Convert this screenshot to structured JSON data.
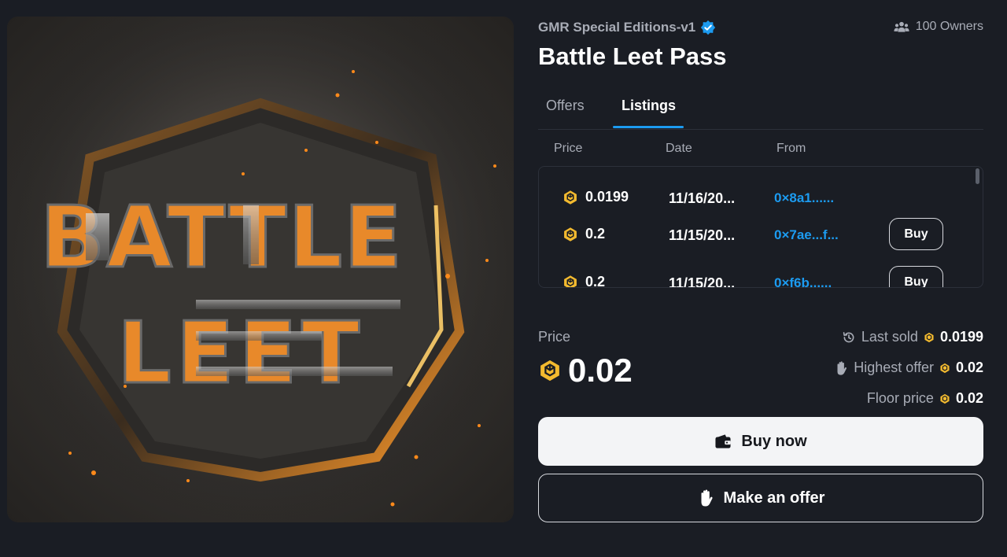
{
  "artwork": {
    "alt_text_logo": "BATTLE LEET"
  },
  "header": {
    "collection_name": "GMR Special Editions-v1",
    "owners_text": "100 Owners",
    "title": "Battle Leet Pass"
  },
  "tabs": [
    {
      "label": "Offers",
      "active": false
    },
    {
      "label": "Listings",
      "active": true
    }
  ],
  "listings": {
    "columns": [
      "Price",
      "Date",
      "From"
    ],
    "rows": [
      {
        "price": "0.0199",
        "date": "11/16/20...",
        "from": "0×8a1......",
        "action": ""
      },
      {
        "price": "0.2",
        "date": "11/15/20...",
        "from": "0×7ae...f...",
        "action": "Buy"
      },
      {
        "price": "0.2",
        "date": "11/15/20...",
        "from": "0×f6b......",
        "action": "Buy"
      }
    ]
  },
  "pricing": {
    "label": "Price",
    "value": "0.02",
    "last_sold_label": "Last sold",
    "last_sold_value": "0.0199",
    "highest_offer_label": "Highest offer",
    "highest_offer_value": "0.02",
    "floor_price_label": "Floor price",
    "floor_price_value": "0.02"
  },
  "actions": {
    "buy_now": "Buy now",
    "make_offer": "Make an offer"
  },
  "colors": {
    "background": "#1a1d24",
    "accent": "#1c9bf0",
    "coin": "#f3ba2f",
    "muted_text": "#a8acb6"
  },
  "icons": [
    "verified-badge-icon",
    "owners-icon",
    "bnb-coin-icon",
    "history-icon",
    "hand-icon",
    "wallet-icon"
  ]
}
